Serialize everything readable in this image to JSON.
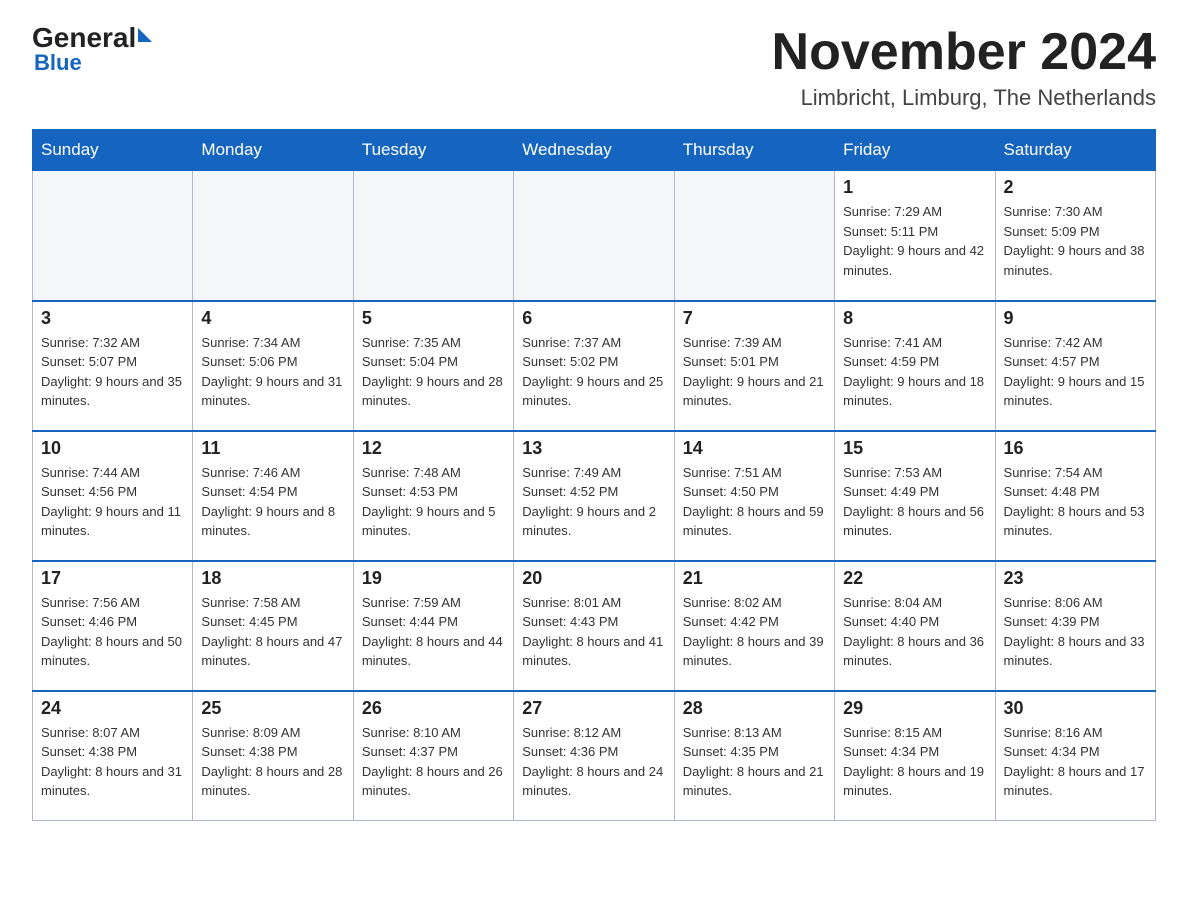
{
  "logo": {
    "general": "General",
    "blue": "Blue"
  },
  "title": "November 2024",
  "subtitle": "Limbricht, Limburg, The Netherlands",
  "days_of_week": [
    "Sunday",
    "Monday",
    "Tuesday",
    "Wednesday",
    "Thursday",
    "Friday",
    "Saturday"
  ],
  "weeks": [
    [
      {
        "day": "",
        "sunrise": "",
        "sunset": "",
        "daylight": "",
        "empty": true
      },
      {
        "day": "",
        "sunrise": "",
        "sunset": "",
        "daylight": "",
        "empty": true
      },
      {
        "day": "",
        "sunrise": "",
        "sunset": "",
        "daylight": "",
        "empty": true
      },
      {
        "day": "",
        "sunrise": "",
        "sunset": "",
        "daylight": "",
        "empty": true
      },
      {
        "day": "",
        "sunrise": "",
        "sunset": "",
        "daylight": "",
        "empty": true
      },
      {
        "day": "1",
        "sunrise": "Sunrise: 7:29 AM",
        "sunset": "Sunset: 5:11 PM",
        "daylight": "Daylight: 9 hours and 42 minutes.",
        "empty": false
      },
      {
        "day": "2",
        "sunrise": "Sunrise: 7:30 AM",
        "sunset": "Sunset: 5:09 PM",
        "daylight": "Daylight: 9 hours and 38 minutes.",
        "empty": false
      }
    ],
    [
      {
        "day": "3",
        "sunrise": "Sunrise: 7:32 AM",
        "sunset": "Sunset: 5:07 PM",
        "daylight": "Daylight: 9 hours and 35 minutes.",
        "empty": false
      },
      {
        "day": "4",
        "sunrise": "Sunrise: 7:34 AM",
        "sunset": "Sunset: 5:06 PM",
        "daylight": "Daylight: 9 hours and 31 minutes.",
        "empty": false
      },
      {
        "day": "5",
        "sunrise": "Sunrise: 7:35 AM",
        "sunset": "Sunset: 5:04 PM",
        "daylight": "Daylight: 9 hours and 28 minutes.",
        "empty": false
      },
      {
        "day": "6",
        "sunrise": "Sunrise: 7:37 AM",
        "sunset": "Sunset: 5:02 PM",
        "daylight": "Daylight: 9 hours and 25 minutes.",
        "empty": false
      },
      {
        "day": "7",
        "sunrise": "Sunrise: 7:39 AM",
        "sunset": "Sunset: 5:01 PM",
        "daylight": "Daylight: 9 hours and 21 minutes.",
        "empty": false
      },
      {
        "day": "8",
        "sunrise": "Sunrise: 7:41 AM",
        "sunset": "Sunset: 4:59 PM",
        "daylight": "Daylight: 9 hours and 18 minutes.",
        "empty": false
      },
      {
        "day": "9",
        "sunrise": "Sunrise: 7:42 AM",
        "sunset": "Sunset: 4:57 PM",
        "daylight": "Daylight: 9 hours and 15 minutes.",
        "empty": false
      }
    ],
    [
      {
        "day": "10",
        "sunrise": "Sunrise: 7:44 AM",
        "sunset": "Sunset: 4:56 PM",
        "daylight": "Daylight: 9 hours and 11 minutes.",
        "empty": false
      },
      {
        "day": "11",
        "sunrise": "Sunrise: 7:46 AM",
        "sunset": "Sunset: 4:54 PM",
        "daylight": "Daylight: 9 hours and 8 minutes.",
        "empty": false
      },
      {
        "day": "12",
        "sunrise": "Sunrise: 7:48 AM",
        "sunset": "Sunset: 4:53 PM",
        "daylight": "Daylight: 9 hours and 5 minutes.",
        "empty": false
      },
      {
        "day": "13",
        "sunrise": "Sunrise: 7:49 AM",
        "sunset": "Sunset: 4:52 PM",
        "daylight": "Daylight: 9 hours and 2 minutes.",
        "empty": false
      },
      {
        "day": "14",
        "sunrise": "Sunrise: 7:51 AM",
        "sunset": "Sunset: 4:50 PM",
        "daylight": "Daylight: 8 hours and 59 minutes.",
        "empty": false
      },
      {
        "day": "15",
        "sunrise": "Sunrise: 7:53 AM",
        "sunset": "Sunset: 4:49 PM",
        "daylight": "Daylight: 8 hours and 56 minutes.",
        "empty": false
      },
      {
        "day": "16",
        "sunrise": "Sunrise: 7:54 AM",
        "sunset": "Sunset: 4:48 PM",
        "daylight": "Daylight: 8 hours and 53 minutes.",
        "empty": false
      }
    ],
    [
      {
        "day": "17",
        "sunrise": "Sunrise: 7:56 AM",
        "sunset": "Sunset: 4:46 PM",
        "daylight": "Daylight: 8 hours and 50 minutes.",
        "empty": false
      },
      {
        "day": "18",
        "sunrise": "Sunrise: 7:58 AM",
        "sunset": "Sunset: 4:45 PM",
        "daylight": "Daylight: 8 hours and 47 minutes.",
        "empty": false
      },
      {
        "day": "19",
        "sunrise": "Sunrise: 7:59 AM",
        "sunset": "Sunset: 4:44 PM",
        "daylight": "Daylight: 8 hours and 44 minutes.",
        "empty": false
      },
      {
        "day": "20",
        "sunrise": "Sunrise: 8:01 AM",
        "sunset": "Sunset: 4:43 PM",
        "daylight": "Daylight: 8 hours and 41 minutes.",
        "empty": false
      },
      {
        "day": "21",
        "sunrise": "Sunrise: 8:02 AM",
        "sunset": "Sunset: 4:42 PM",
        "daylight": "Daylight: 8 hours and 39 minutes.",
        "empty": false
      },
      {
        "day": "22",
        "sunrise": "Sunrise: 8:04 AM",
        "sunset": "Sunset: 4:40 PM",
        "daylight": "Daylight: 8 hours and 36 minutes.",
        "empty": false
      },
      {
        "day": "23",
        "sunrise": "Sunrise: 8:06 AM",
        "sunset": "Sunset: 4:39 PM",
        "daylight": "Daylight: 8 hours and 33 minutes.",
        "empty": false
      }
    ],
    [
      {
        "day": "24",
        "sunrise": "Sunrise: 8:07 AM",
        "sunset": "Sunset: 4:38 PM",
        "daylight": "Daylight: 8 hours and 31 minutes.",
        "empty": false
      },
      {
        "day": "25",
        "sunrise": "Sunrise: 8:09 AM",
        "sunset": "Sunset: 4:38 PM",
        "daylight": "Daylight: 8 hours and 28 minutes.",
        "empty": false
      },
      {
        "day": "26",
        "sunrise": "Sunrise: 8:10 AM",
        "sunset": "Sunset: 4:37 PM",
        "daylight": "Daylight: 8 hours and 26 minutes.",
        "empty": false
      },
      {
        "day": "27",
        "sunrise": "Sunrise: 8:12 AM",
        "sunset": "Sunset: 4:36 PM",
        "daylight": "Daylight: 8 hours and 24 minutes.",
        "empty": false
      },
      {
        "day": "28",
        "sunrise": "Sunrise: 8:13 AM",
        "sunset": "Sunset: 4:35 PM",
        "daylight": "Daylight: 8 hours and 21 minutes.",
        "empty": false
      },
      {
        "day": "29",
        "sunrise": "Sunrise: 8:15 AM",
        "sunset": "Sunset: 4:34 PM",
        "daylight": "Daylight: 8 hours and 19 minutes.",
        "empty": false
      },
      {
        "day": "30",
        "sunrise": "Sunrise: 8:16 AM",
        "sunset": "Sunset: 4:34 PM",
        "daylight": "Daylight: 8 hours and 17 minutes.",
        "empty": false
      }
    ]
  ]
}
